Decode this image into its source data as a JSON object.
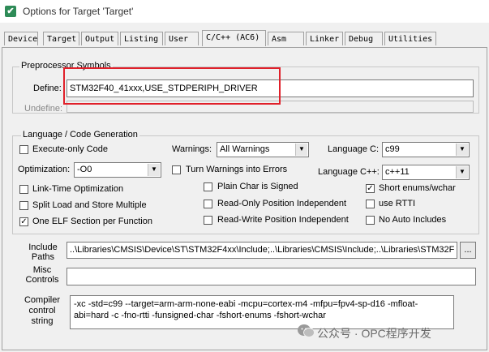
{
  "window": {
    "title": "Options for Target 'Target'"
  },
  "tabs": [
    "Device",
    "Target",
    "Output",
    "Listing",
    "User",
    "C/C++ (AC6)",
    "Asm",
    "Linker",
    "Debug",
    "Utilities"
  ],
  "preprocessor": {
    "group_label": "Preprocessor Symbols",
    "define_label": "Define:",
    "define_value": "STM32F40_41xxx,USE_STDPERIPH_DRIVER",
    "undefine_label": "Undefine:",
    "undefine_value": ""
  },
  "language": {
    "group_label": "Language / Code Generation",
    "execute_only": {
      "label": "Execute-only Code",
      "checked": false
    },
    "warnings_label": "Warnings:",
    "warnings_value": "All Warnings",
    "language_c_label": "Language C:",
    "language_c_value": "c99",
    "optimization_label": "Optimization:",
    "optimization_value": "-O0",
    "turn_warnings_errors": {
      "label": "Turn Warnings into Errors",
      "checked": false
    },
    "language_cpp_label": "Language C++:",
    "language_cpp_value": "c++11",
    "link_time_opt": {
      "label": "Link-Time Optimization",
      "checked": false
    },
    "plain_char_signed": {
      "label": "Plain Char is Signed",
      "checked": false
    },
    "short_enums": {
      "label": "Short enums/wchar",
      "checked": true
    },
    "split_load_store": {
      "label": "Split Load and Store Multiple",
      "checked": false
    },
    "ro_position_independent": {
      "label": "Read-Only Position Independent",
      "checked": false
    },
    "use_rtti": {
      "label": "use RTTI",
      "checked": false
    },
    "one_elf_section": {
      "label": "One ELF Section per Function",
      "checked": true
    },
    "rw_position_independent": {
      "label": "Read-Write Position Independent",
      "checked": false
    },
    "no_auto_includes": {
      "label": "No Auto Includes",
      "checked": false
    }
  },
  "include_paths": {
    "label_line1": "Include",
    "label_line2": "Paths",
    "value": "..\\Libraries\\CMSIS\\Device\\ST\\STM32F4xx\\Include;..\\Libraries\\CMSIS\\Include;..\\Libraries\\STM32F",
    "browse_label": "..."
  },
  "misc_controls": {
    "label_line1": "Misc",
    "label_line2": "Controls",
    "value": ""
  },
  "compiler_control": {
    "label_line1": "Compiler",
    "label_line2": "control",
    "label_line3": "string",
    "value": "-xc -std=c99 --target=arm-arm-none-eabi -mcpu=cortex-m4 -mfpu=fpv4-sp-d16 -mfloat-abi=hard -c -fno-rtti -funsigned-char -fshort-enums -fshort-wchar"
  },
  "watermark": {
    "text": "公众号 · OPC程序开发"
  },
  "colors": {
    "highlight": "#e0202a",
    "app_icon": "#2e8b57"
  }
}
